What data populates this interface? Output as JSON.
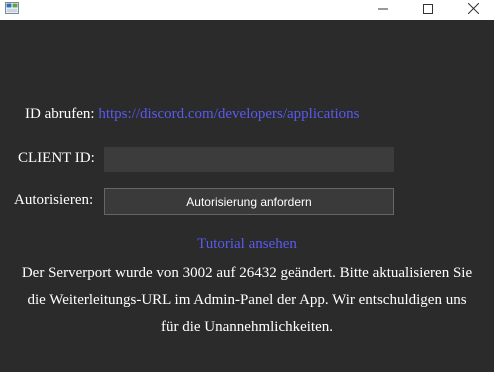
{
  "window": {
    "icon": "app-window-icon",
    "controls": {
      "minimize_icon": "minimize-icon",
      "maximize_icon": "maximize-icon",
      "close_icon": "close-icon"
    }
  },
  "id_row": {
    "label": "ID abrufen:",
    "link_text": "https://discord.com/developers/applications"
  },
  "client_id": {
    "label": "CLIENT ID:",
    "value": "",
    "placeholder": ""
  },
  "authorize": {
    "label": "Autorisieren:",
    "button_label": "Autorisierung anfordern"
  },
  "tutorial_link": "Tutorial ansehen",
  "notice": {
    "line1": "Der Serverport wurde von 3002 auf 26432 geändert. Bitte aktualisieren Sie",
    "line2": "die Weiterleitungs-URL im Admin-Panel der App. Wir entschuldigen uns",
    "line3": "für die Unannehmlichkeiten."
  },
  "colors": {
    "background": "#2b2b2b",
    "titlebar": "#ffffff",
    "text": "#ffffff",
    "link": "#5a5af0",
    "input_bg": "#3c3c3c",
    "button_bg": "#3a3a3a",
    "button_border": "#666666"
  }
}
